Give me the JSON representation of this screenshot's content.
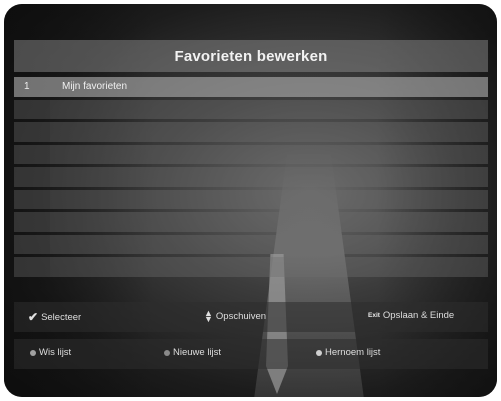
{
  "title": "Favorieten bewerken",
  "list": {
    "rows": [
      {
        "number": "1",
        "name": "Mijn favorieten",
        "selected": true
      },
      {
        "number": "",
        "name": "",
        "selected": false
      },
      {
        "number": "",
        "name": "",
        "selected": false
      },
      {
        "number": "",
        "name": "",
        "selected": false
      },
      {
        "number": "",
        "name": "",
        "selected": false
      },
      {
        "number": "",
        "name": "",
        "selected": false
      },
      {
        "number": "",
        "name": "",
        "selected": false
      },
      {
        "number": "",
        "name": "",
        "selected": false
      },
      {
        "number": "",
        "name": "",
        "selected": false
      }
    ]
  },
  "footer": {
    "select": {
      "label": "Selecteer",
      "icon": "check-icon"
    },
    "move": {
      "label": "Opschuiven",
      "icon": "up-down-arrows-icon"
    },
    "save_exit": {
      "key": "Exit",
      "label": "Opslaan & Einde",
      "icon": "exit-key-icon"
    },
    "delete_list": {
      "label": "Wis lijst",
      "icon": "red-key-icon",
      "color": "#a0a0a0"
    },
    "new_list": {
      "label": "Nieuwe lijst",
      "icon": "green-key-icon",
      "color": "#8a8a8a"
    },
    "rename_list": {
      "label": "Hernoem lijst",
      "icon": "yellow-key-icon",
      "color": "#d0d0d0"
    }
  }
}
